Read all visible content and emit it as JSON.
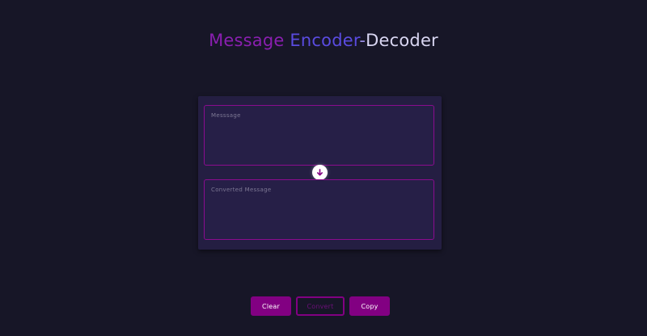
{
  "header": {
    "title_part1": "Message",
    "title_part2": "Encoder",
    "title_part3": "-",
    "title_part4": "Decoder"
  },
  "form": {
    "message_placeholder": "Messsage",
    "converted_placeholder": "Converted Message",
    "swap_icon": "arrow-down-icon"
  },
  "actions": {
    "clear_label": "Clear",
    "convert_label": "Convert",
    "copy_label": "Copy"
  },
  "colors": {
    "background": "#171627",
    "card": "#241e42",
    "accent": "#820082",
    "title_purple": "#8a1fb0",
    "title_blue": "#5a4be0",
    "title_light": "#d9d6f2"
  }
}
